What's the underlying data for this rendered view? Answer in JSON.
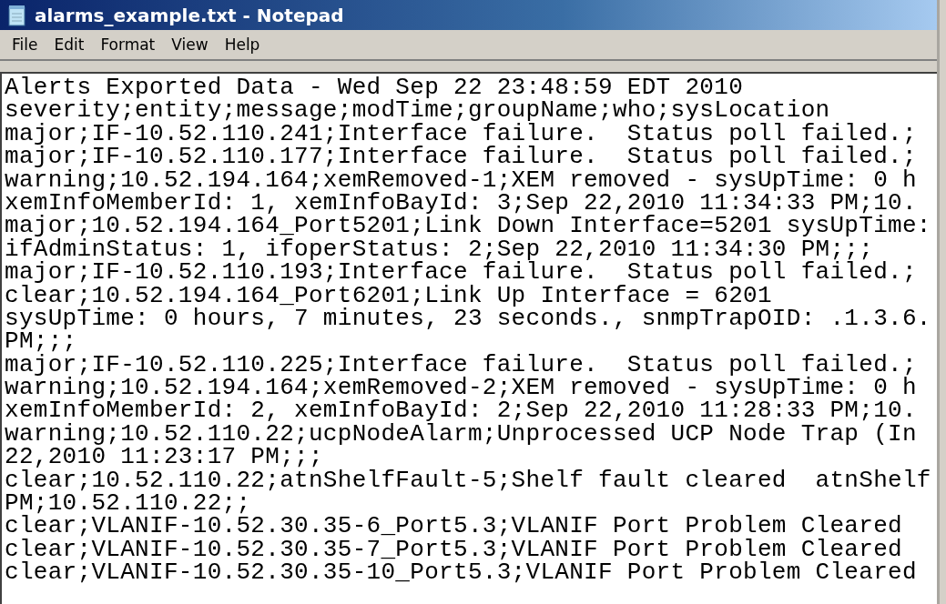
{
  "window": {
    "title": "alarms_example.txt - Notepad"
  },
  "menu": [
    "File",
    "Edit",
    "Format",
    "View",
    "Help"
  ],
  "text_lines": [
    "Alerts Exported Data - Wed Sep 22 23:48:59 EDT 2010",
    "severity;entity;message;modTime;groupName;who;sysLocation",
    "major;IF-10.52.110.241;Interface failure.  Status poll failed.;",
    "major;IF-10.52.110.177;Interface failure.  Status poll failed.;",
    "warning;10.52.194.164;xemRemoved-1;XEM removed - sysUpTime: 0 h",
    "xemInfoMemberId: 1, xemInfoBayId: 3;Sep 22,2010 11:34:33 PM;10.",
    "major;10.52.194.164_Port5201;Link Down Interface=5201 sysUpTime:",
    "ifAdminStatus: 1, ifoperStatus: 2;Sep 22,2010 11:34:30 PM;;;",
    "major;IF-10.52.110.193;Interface failure.  Status poll failed.;",
    "clear;10.52.194.164_Port6201;Link Up Interface = 6201",
    "sysUpTime: 0 hours, 7 minutes, 23 seconds., snmpTrapOID: .1.3.6.",
    "PM;;;",
    "major;IF-10.52.110.225;Interface failure.  Status poll failed.;",
    "warning;10.52.194.164;xemRemoved-2;XEM removed - sysUpTime: 0 h",
    "xemInfoMemberId: 2, xemInfoBayId: 2;Sep 22,2010 11:28:33 PM;10.",
    "warning;10.52.110.22;ucpNodeAlarm;Unprocessed UCP Node Trap (In",
    "22,2010 11:23:17 PM;;;",
    "clear;10.52.110.22;atnShelfFault-5;Shelf fault cleared  atnShelf",
    "PM;10.52.110.22;;",
    "clear;VLANIF-10.52.30.35-6_Port5.3;VLANIF Port Problem Cleared",
    "clear;VLANIF-10.52.30.35-7_Port5.3;VLANIF Port Problem Cleared",
    "clear;VLANIF-10.52.30.35-10_Port5.3;VLANIF Port Problem Cleared"
  ]
}
